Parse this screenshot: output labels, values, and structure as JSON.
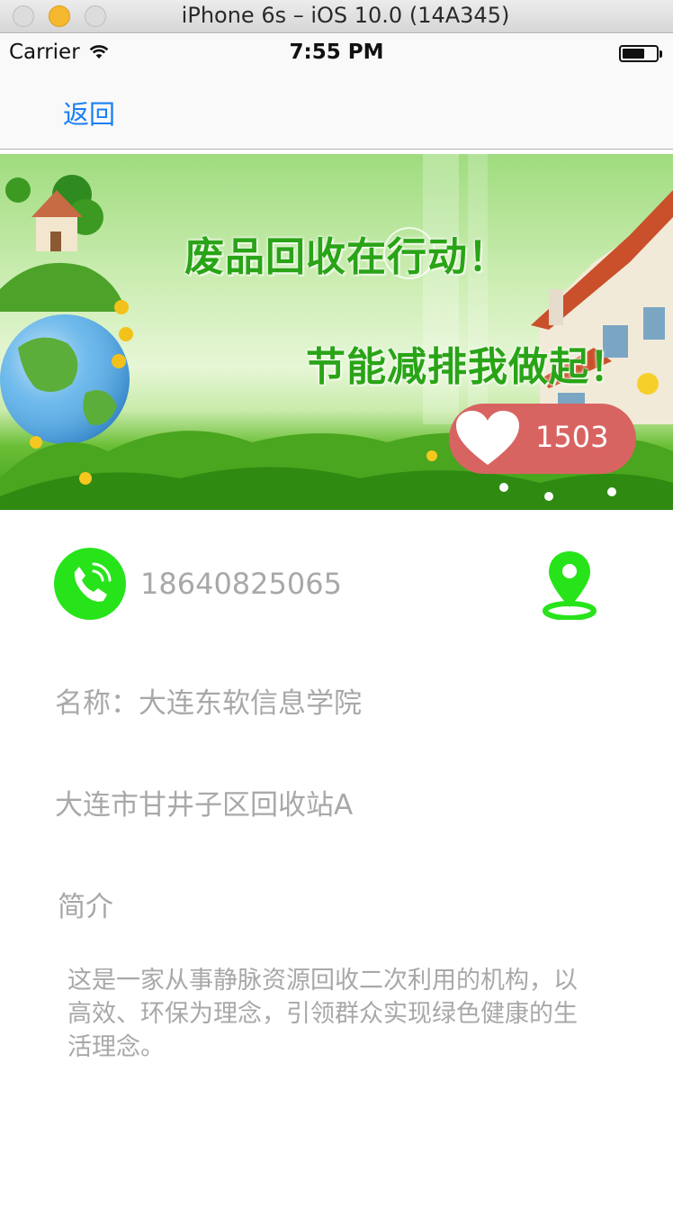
{
  "window": {
    "title": "iPhone 6s – iOS 10.0 (14A345)"
  },
  "status_bar": {
    "carrier": "Carrier",
    "time": "7:55 PM"
  },
  "nav": {
    "back_label": "返回"
  },
  "banner": {
    "slogan_1": "废品回收在行动！",
    "slogan_2": "节能减排我做起！",
    "like_count": "1503"
  },
  "detail": {
    "phone": "18640825065",
    "name": "名称：大连东软信息学院",
    "address": "大连市甘井子区回收站A",
    "intro_heading": "简介",
    "intro_text": "这是一家从事静脉资源回收二次利用的机构，以高效、环保为理念，引领群众实现绿色健康的生活理念。"
  },
  "colors": {
    "accent_blue": "#1a7ff5",
    "like_red": "#d86462",
    "phone_green": "#27e41a",
    "text_gray": "#a8a8a8"
  },
  "icons": {
    "phone": "phone-icon",
    "location": "location-pin-icon",
    "like": "heart-icon"
  }
}
